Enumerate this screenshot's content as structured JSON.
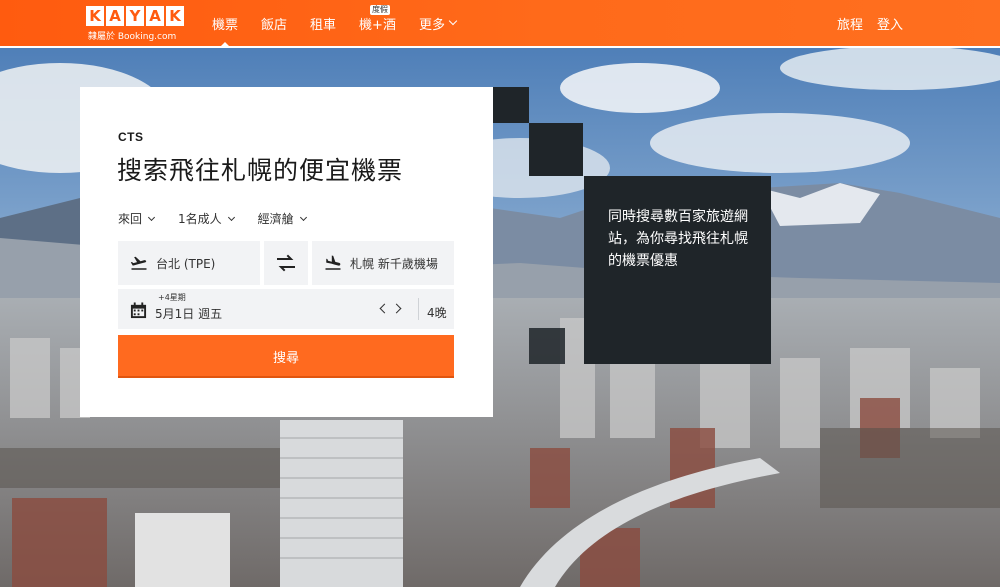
{
  "header": {
    "logo_letters": [
      "K",
      "A",
      "Y",
      "A",
      "K"
    ],
    "logo_subtitle": "隸屬於 Booking.com",
    "nav": [
      {
        "label": "機票",
        "active": true
      },
      {
        "label": "飯店"
      },
      {
        "label": "租車"
      },
      {
        "label": "機+酒",
        "badge": "度假"
      },
      {
        "label": "更多"
      }
    ],
    "trips_label": "旅程",
    "login_label": "登入"
  },
  "search": {
    "brand": "CTS",
    "headline": "搜索飛往札幌的便宜機票",
    "trip_type": "來回",
    "travelers": "1名成人",
    "cabin": "經濟艙",
    "origin": "台北 (TPE)",
    "destination": "札幌 新千歲機場",
    "date_hint": "+4星期",
    "date": "5月1日 週五",
    "nights": "4晚",
    "search_button": "搜尋"
  },
  "promo": {
    "text": "同時搜尋數百家旅遊網站，為你尋找飛往札幌的機票優惠"
  },
  "colors": {
    "brand_orange": "#ff6a1f",
    "dark_panel": "#1f2529",
    "field_bg": "#f2f3f5"
  }
}
